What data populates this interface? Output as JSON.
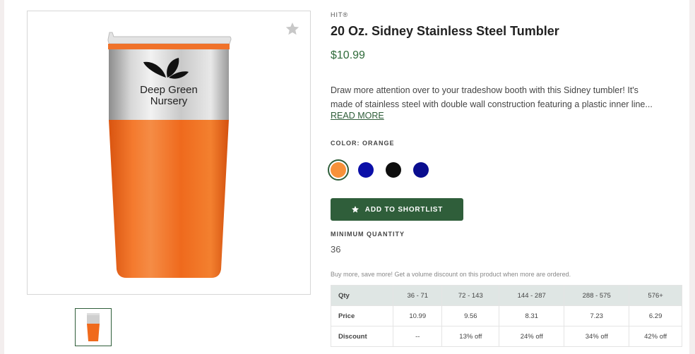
{
  "product": {
    "brand": "HIT®",
    "title": "20 Oz. Sidney Stainless Steel Tumbler",
    "price": "$10.99",
    "description_line1": "Draw more attention over to your tradeshow booth with this Sidney tumbler! It's",
    "description_line2": "made of stainless steel with double wall construction featuring a plastic inner line...",
    "read_more": "READ MORE",
    "imprint_line1": "Deep Green",
    "imprint_line2": "Nursery"
  },
  "color": {
    "label": "COLOR: ORANGE",
    "swatches": [
      {
        "name": "Orange",
        "hex": "#f7913a",
        "selected": true
      },
      {
        "name": "Royal Blue",
        "hex": "#0b0fa8",
        "selected": false
      },
      {
        "name": "Black",
        "hex": "#0e0e0e",
        "selected": false
      },
      {
        "name": "Navy",
        "hex": "#0a0d8f",
        "selected": false
      }
    ]
  },
  "actions": {
    "shortlist_label": "ADD TO SHORTLIST"
  },
  "minimum_quantity": {
    "label": "MINIMUM QUANTITY",
    "value": "36"
  },
  "volume": {
    "note": "Buy more, save more! Get a volume discount on this product when more are ordered.",
    "header": [
      "Qty",
      "36 - 71",
      "72 - 143",
      "144 - 287",
      "288 - 575",
      "576+"
    ],
    "price_row": [
      "Price",
      "10.99",
      "9.56",
      "8.31",
      "7.23",
      "6.29"
    ],
    "discount_row": [
      "Discount",
      "--",
      "13% off",
      "24% off",
      "34% off",
      "42% off"
    ]
  },
  "colors": {
    "accent": "#2f5e3a",
    "price_text": "#2f6b3a",
    "tumbler_orange": "#f26a1b",
    "table_header_bg": "#dfe6e4"
  },
  "icons": {
    "favorite": "star-icon",
    "shortlist": "star-icon"
  }
}
